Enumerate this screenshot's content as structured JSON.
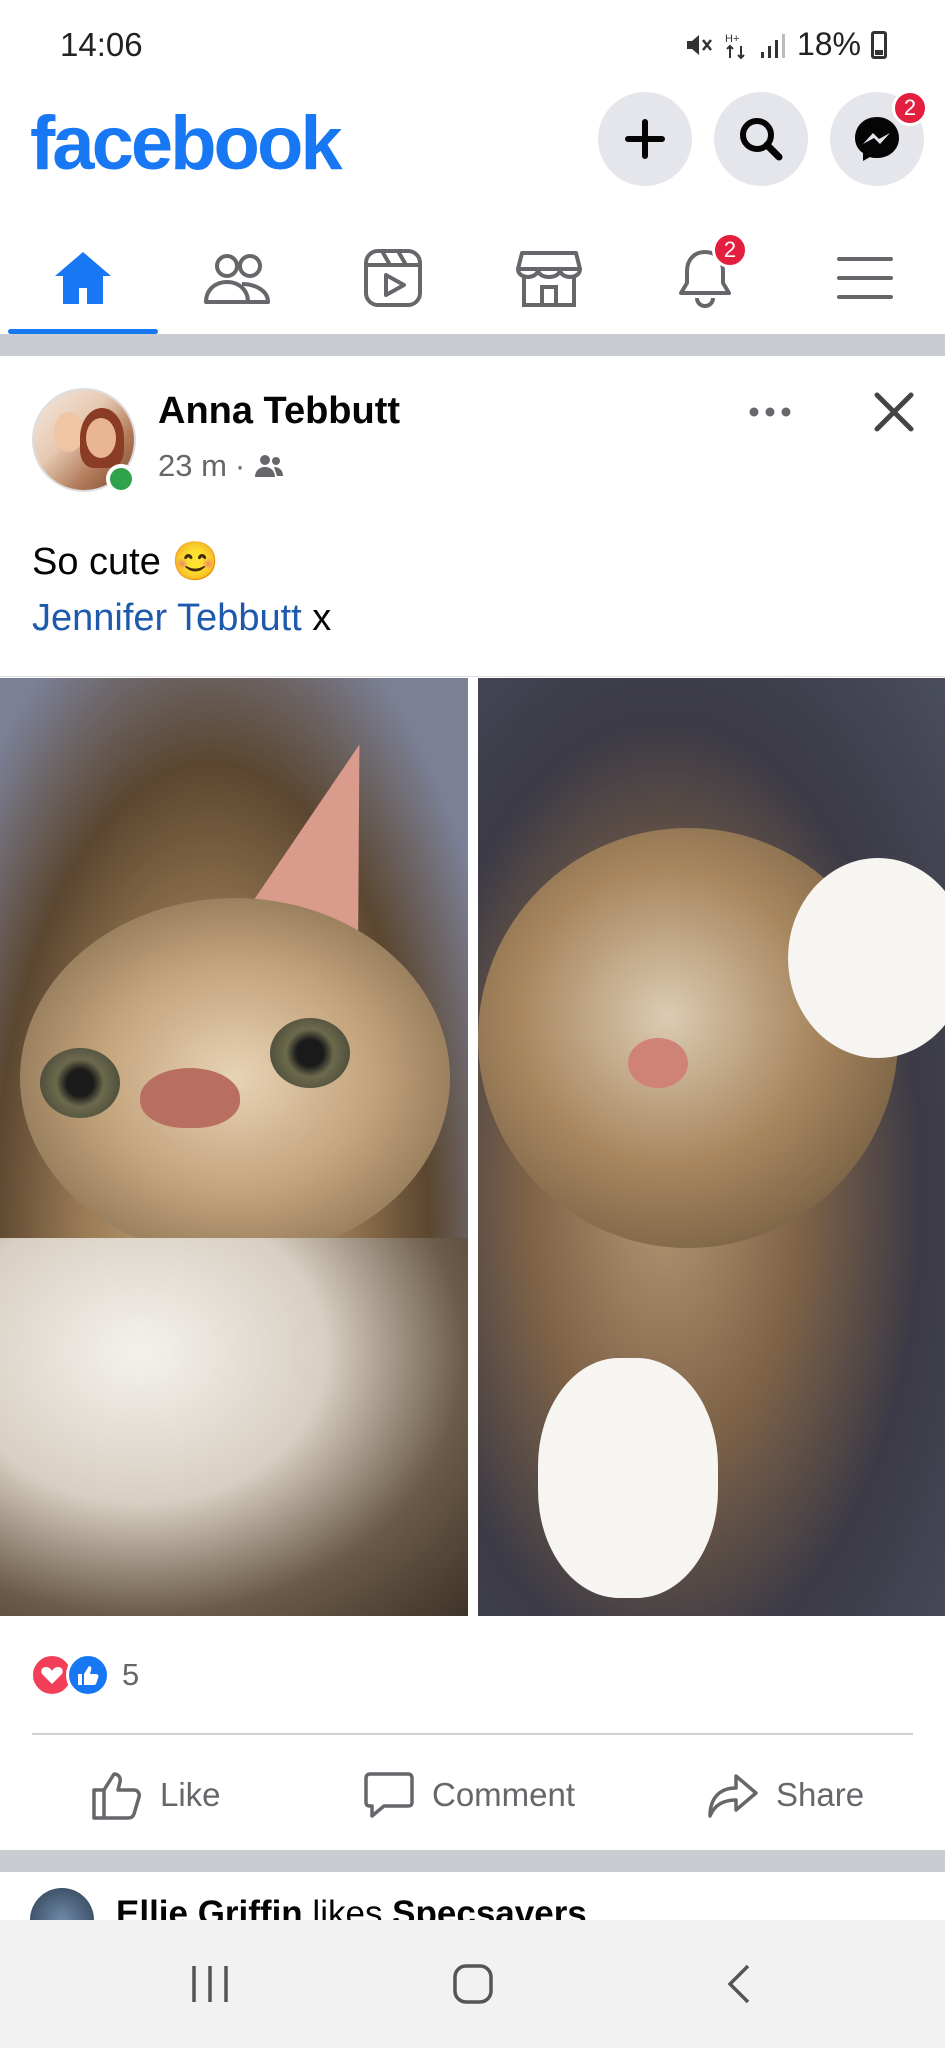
{
  "status_bar": {
    "time": "14:06",
    "battery": "18%"
  },
  "header": {
    "logo": "facebook",
    "messenger_badge": "2",
    "icons": [
      "plus-icon",
      "search-icon",
      "messenger-icon"
    ]
  },
  "tabs": [
    {
      "name": "home",
      "icon": "home-icon",
      "active": true
    },
    {
      "name": "friends",
      "icon": "friends-icon"
    },
    {
      "name": "watch",
      "icon": "watch-icon"
    },
    {
      "name": "marketplace",
      "icon": "marketplace-icon"
    },
    {
      "name": "notifications",
      "icon": "bell-icon",
      "badge": "2"
    },
    {
      "name": "menu",
      "icon": "menu-icon"
    }
  ],
  "post": {
    "author": "Anna Tebbutt",
    "time": "23 m",
    "separator": "·",
    "text_line1": "So cute",
    "emoji": "😊",
    "mention": "Jennifer Tebbutt",
    "mention_suffix": " x",
    "reaction_count": "5",
    "actions": {
      "like": "Like",
      "comment": "Comment",
      "share": "Share"
    }
  },
  "next_post": {
    "actor": "Ellie Griffin",
    "verb": " likes ",
    "object": "Specsavers"
  },
  "colors": {
    "brand": "#1877f2",
    "badge": "#e41e3f",
    "online": "#31a24c",
    "mention": "#1d5aab",
    "love": "#f33e58"
  }
}
